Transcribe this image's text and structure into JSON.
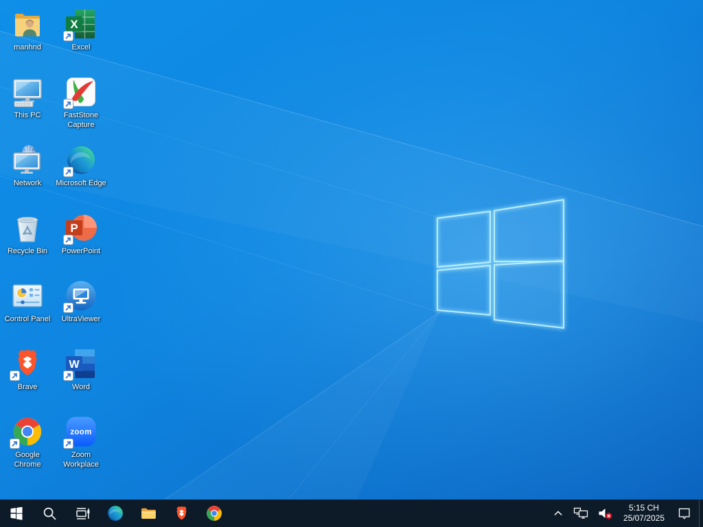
{
  "desktop": {
    "icons": [
      {
        "id": "user-folder",
        "label": "manhnd"
      },
      {
        "id": "this-pc",
        "label": "This PC"
      },
      {
        "id": "network",
        "label": "Network"
      },
      {
        "id": "recycle-bin",
        "label": "Recycle Bin"
      },
      {
        "id": "control-panel",
        "label": "Control Panel"
      },
      {
        "id": "brave",
        "label": "Brave"
      },
      {
        "id": "google-chrome",
        "label": "Google Chrome"
      },
      {
        "id": "excel",
        "label": "Excel"
      },
      {
        "id": "faststone-capture",
        "label": "FastStone Capture"
      },
      {
        "id": "microsoft-edge",
        "label": "Microsoft Edge"
      },
      {
        "id": "powerpoint",
        "label": "PowerPoint"
      },
      {
        "id": "ultraviewer",
        "label": "UltraViewer"
      },
      {
        "id": "word",
        "label": "Word"
      },
      {
        "id": "zoom-workplace",
        "label": "Zoom Workplace"
      }
    ]
  },
  "logo_letters": {
    "excel": "X",
    "powerpoint": "P",
    "word": "W",
    "zoom": "zoom"
  },
  "taskbar": {
    "icons": [
      "start",
      "search",
      "task-view",
      "edge",
      "file-explorer",
      "brave",
      "chrome"
    ]
  },
  "tray": {
    "icons": [
      "chevron-up",
      "network",
      "volume-muted",
      "action-center",
      "show-desktop"
    ],
    "time": "5:15 CH",
    "date": "25/07/2025"
  },
  "colors": {
    "taskbar_bg": "#0d1b29",
    "wallpaper_light": "#14a0f2",
    "wallpaper_base": "#0f85e0",
    "wallpaper_dark": "#0a63c0",
    "logo_stroke": "#b8eeff",
    "volume_mute_badge": "#e81123"
  }
}
